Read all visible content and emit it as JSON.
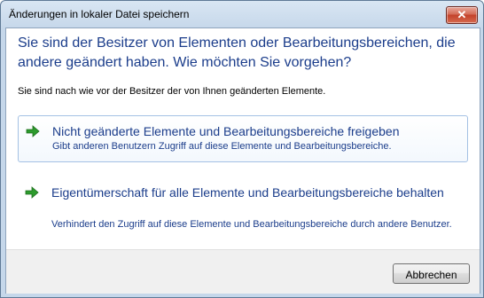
{
  "window": {
    "title": "Änderungen in lokaler Datei speichern",
    "close_symbol": "✕"
  },
  "dialog": {
    "heading": "Sie sind der Besitzer von Elementen oder Bearbeitungsbereichen, die andere geändert haben. Wie möchten Sie vorgehen?",
    "intro": "Sie sind nach wie vor der Besitzer der von Ihnen geänderten Elemente.",
    "options": [
      {
        "title": "Nicht geänderte Elemente und Bearbeitungsbereiche freigeben",
        "description": "Gibt anderen Benutzern Zugriff auf diese Elemente und Bearbeitungsbereiche.",
        "icon": "green-arrow-icon"
      },
      {
        "title": "Eigentümerschaft für alle Elemente und Bearbeitungsbereiche behalten",
        "description": "Verhindert den Zugriff auf diese Elemente und Bearbeitungsbereiche durch andere Benutzer.",
        "icon": "green-arrow-icon"
      }
    ],
    "cancel_label": "Abbrechen"
  },
  "colors": {
    "heading": "#1b3d8b",
    "arrow": "#2d9b2d",
    "close_button": "#c3412a"
  }
}
